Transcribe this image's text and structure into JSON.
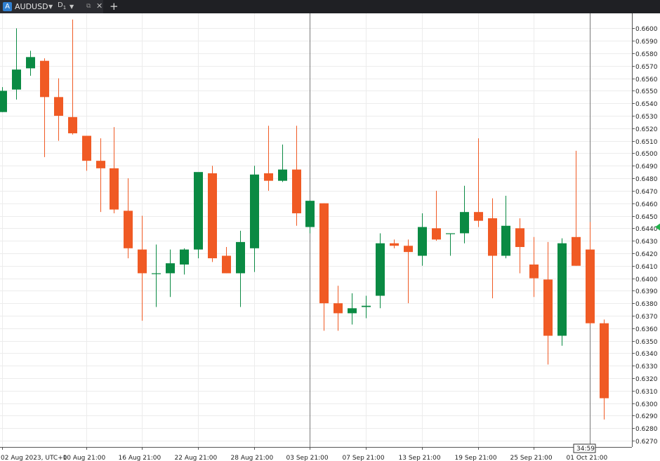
{
  "tab": {
    "icon_letter": "A",
    "title": "AUDUSD",
    "timeframe_prefix": "D",
    "timeframe_sub": "1",
    "close_glyph": "✕",
    "add_glyph": "+"
  },
  "colors": {
    "background": "#ffffff",
    "grid": "#ececec",
    "bull": "#0a8a43",
    "bear": "#f05a24",
    "current_price_marker": "#22b14c",
    "watermark_pink": "#ef6f80",
    "watermark_orange": "#f7b54a"
  },
  "chart_data": {
    "type": "candlestick",
    "symbol": "AUDUSD",
    "timeframe": "D1",
    "ylim": [
      0.6265,
      0.6612
    ],
    "y_ticks": [
      "0.6600",
      "0.6590",
      "0.6580",
      "0.6570",
      "0.6560",
      "0.6550",
      "0.6540",
      "0.6530",
      "0.6520",
      "0.6510",
      "0.6500",
      "0.6490",
      "0.6480",
      "0.6470",
      "0.6460",
      "0.6450",
      "0.6440",
      "0.6430",
      "0.6420",
      "0.6410",
      "0.6400",
      "0.6390",
      "0.6380",
      "0.6370",
      "0.6360",
      "0.6350",
      "0.6340",
      "0.6330",
      "0.6320",
      "0.6310",
      "0.6300",
      "0.6290",
      "0.6280",
      "0.6270"
    ],
    "x_ticks": [
      {
        "label": "02 Aug 2023, UTC+0",
        "index": 0
      },
      {
        "label": "10 Aug 21:00",
        "index": 6
      },
      {
        "label": "16 Aug 21:00",
        "index": 10
      },
      {
        "label": "22 Aug 21:00",
        "index": 14
      },
      {
        "label": "28 Aug 21:00",
        "index": 18
      },
      {
        "label": "03 Sep 21:00",
        "index": 22
      },
      {
        "label": "07 Sep 21:00",
        "index": 26
      },
      {
        "label": "13 Sep 21:00",
        "index": 30
      },
      {
        "label": "19 Sep 21:00",
        "index": 34
      },
      {
        "label": "25 Sep 21:00",
        "index": 38
      },
      {
        "label": "01 Oct 21:00",
        "index": 42
      }
    ],
    "vertical_lines": [
      22,
      42
    ],
    "timer_label": "34:59",
    "candles": [
      {
        "o": 0.6533,
        "h": 0.6553,
        "l": 0.6533,
        "c": 0.655
      },
      {
        "o": 0.6551,
        "h": 0.66,
        "l": 0.6543,
        "c": 0.6567
      },
      {
        "o": 0.6568,
        "h": 0.6582,
        "l": 0.6562,
        "c": 0.6577
      },
      {
        "o": 0.6574,
        "h": 0.6576,
        "l": 0.6497,
        "c": 0.6545
      },
      {
        "o": 0.6545,
        "h": 0.656,
        "l": 0.651,
        "c": 0.653
      },
      {
        "o": 0.6529,
        "h": 0.6607,
        "l": 0.6515,
        "c": 0.6516
      },
      {
        "o": 0.6514,
        "h": 0.6514,
        "l": 0.6486,
        "c": 0.6494
      },
      {
        "o": 0.6494,
        "h": 0.6512,
        "l": 0.6453,
        "c": 0.6488
      },
      {
        "o": 0.6488,
        "h": 0.6521,
        "l": 0.6452,
        "c": 0.6455
      },
      {
        "o": 0.6454,
        "h": 0.648,
        "l": 0.6416,
        "c": 0.6424
      },
      {
        "o": 0.6423,
        "h": 0.645,
        "l": 0.6366,
        "c": 0.6404
      },
      {
        "o": 0.6404,
        "h": 0.6427,
        "l": 0.6377,
        "c": 0.6404
      },
      {
        "o": 0.6404,
        "h": 0.6423,
        "l": 0.6385,
        "c": 0.6412
      },
      {
        "o": 0.6411,
        "h": 0.6424,
        "l": 0.6403,
        "c": 0.6423
      },
      {
        "o": 0.6423,
        "h": 0.6484,
        "l": 0.6416,
        "c": 0.6485
      },
      {
        "o": 0.6484,
        "h": 0.649,
        "l": 0.6413,
        "c": 0.6416
      },
      {
        "o": 0.6418,
        "h": 0.6425,
        "l": 0.6404,
        "c": 0.6404
      },
      {
        "o": 0.6404,
        "h": 0.6438,
        "l": 0.6377,
        "c": 0.6429
      },
      {
        "o": 0.6424,
        "h": 0.649,
        "l": 0.6405,
        "c": 0.6483
      },
      {
        "o": 0.6484,
        "h": 0.6522,
        "l": 0.647,
        "c": 0.6478
      },
      {
        "o": 0.6478,
        "h": 0.6507,
        "l": 0.6477,
        "c": 0.6487
      },
      {
        "o": 0.6487,
        "h": 0.6522,
        "l": 0.6442,
        "c": 0.6452
      },
      {
        "o": 0.6441,
        "h": 0.6462,
        "l": 0.6436,
        "c": 0.6462
      },
      {
        "o": 0.646,
        "h": 0.646,
        "l": 0.6358,
        "c": 0.638
      },
      {
        "o": 0.638,
        "h": 0.6394,
        "l": 0.6358,
        "c": 0.6372
      },
      {
        "o": 0.6372,
        "h": 0.6388,
        "l": 0.6363,
        "c": 0.6376
      },
      {
        "o": 0.6377,
        "h": 0.6386,
        "l": 0.6368,
        "c": 0.6378
      },
      {
        "o": 0.6386,
        "h": 0.6436,
        "l": 0.6376,
        "c": 0.6428
      },
      {
        "o": 0.6428,
        "h": 0.6431,
        "l": 0.6424,
        "c": 0.6426
      },
      {
        "o": 0.6426,
        "h": 0.6431,
        "l": 0.638,
        "c": 0.6421
      },
      {
        "o": 0.6418,
        "h": 0.6452,
        "l": 0.641,
        "c": 0.6441
      },
      {
        "o": 0.644,
        "h": 0.647,
        "l": 0.643,
        "c": 0.6431
      },
      {
        "o": 0.6436,
        "h": 0.6436,
        "l": 0.6418,
        "c": 0.6436
      },
      {
        "o": 0.6436,
        "h": 0.6474,
        "l": 0.6428,
        "c": 0.6453
      },
      {
        "o": 0.6453,
        "h": 0.6512,
        "l": 0.6441,
        "c": 0.6446
      },
      {
        "o": 0.6448,
        "h": 0.6464,
        "l": 0.6384,
        "c": 0.6418
      },
      {
        "o": 0.6418,
        "h": 0.6466,
        "l": 0.6416,
        "c": 0.6442
      },
      {
        "o": 0.644,
        "h": 0.6448,
        "l": 0.6404,
        "c": 0.6425
      },
      {
        "o": 0.6411,
        "h": 0.6433,
        "l": 0.6385,
        "c": 0.64
      },
      {
        "o": 0.6399,
        "h": 0.6429,
        "l": 0.6331,
        "c": 0.6354
      },
      {
        "o": 0.6354,
        "h": 0.6432,
        "l": 0.6346,
        "c": 0.6428
      },
      {
        "o": 0.6433,
        "h": 0.6502,
        "l": 0.641,
        "c": 0.641
      },
      {
        "o": 0.6423,
        "h": 0.6445,
        "l": 0.6363,
        "c": 0.6364
      },
      {
        "o": 0.6364,
        "h": 0.6367,
        "l": 0.6287,
        "c": 0.6304
      }
    ]
  }
}
